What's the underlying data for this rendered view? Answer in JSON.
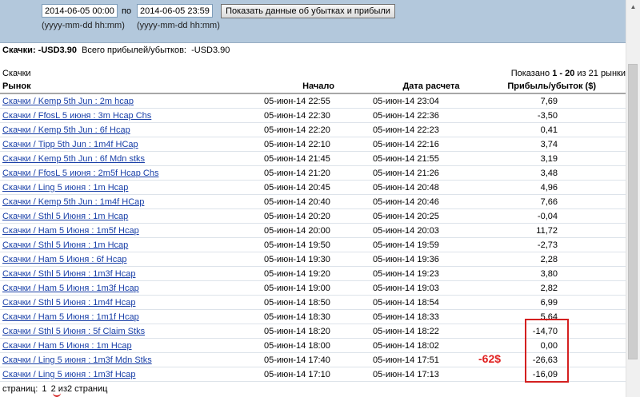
{
  "filter": {
    "date_from": "2014-06-05 00:00",
    "date_to": "2014-06-05 23:59",
    "separator": "по",
    "format_hint": "(yyyy-mm-dd hh:mm)",
    "show_button": "Показать данные об убытках и прибыли"
  },
  "summary": {
    "label": "Скачки: -USD3.90",
    "total_label": "Всего прибылей/убытков:",
    "total_value": "-USD3.90"
  },
  "section_label": "Скачки",
  "shown": {
    "prefix": "Показано",
    "range": "1 - 20",
    "suffix": "из 21 рынки"
  },
  "table": {
    "headers": [
      "Рынок",
      "Начало",
      "Дата расчета",
      "Прибыль/убыток ($)"
    ],
    "rows": [
      {
        "market": "Скачки / Kemp 5th Jun : 2m hcap",
        "start": "05-июн-14 22:55",
        "settled": "05-июн-14 23:04",
        "pl": "7,69"
      },
      {
        "market": "Скачки / FfosL 5 июня : 3m Hcap Chs",
        "start": "05-июн-14 22:30",
        "settled": "05-июн-14 22:36",
        "pl": "-3,50"
      },
      {
        "market": "Скачки / Kemp 5th Jun : 6f Hcap",
        "start": "05-июн-14 22:20",
        "settled": "05-июн-14 22:23",
        "pl": "0,41"
      },
      {
        "market": "Скачки / Tipp 5th Jun : 1m4f HCap",
        "start": "05-июн-14 22:10",
        "settled": "05-июн-14 22:16",
        "pl": "3,74"
      },
      {
        "market": "Скачки / Kemp 5th Jun : 6f Mdn stks",
        "start": "05-июн-14 21:45",
        "settled": "05-июн-14 21:55",
        "pl": "3,19"
      },
      {
        "market": "Скачки / FfosL 5 июня : 2m5f Hcap Chs",
        "start": "05-июн-14 21:20",
        "settled": "05-июн-14 21:26",
        "pl": "3,48"
      },
      {
        "market": "Скачки / Ling 5 июня : 1m Hcap",
        "start": "05-июн-14 20:45",
        "settled": "05-июн-14 20:48",
        "pl": "4,96"
      },
      {
        "market": "Скачки / Kemp 5th Jun : 1m4f HCap",
        "start": "05-июн-14 20:40",
        "settled": "05-июн-14 20:46",
        "pl": "7,66"
      },
      {
        "market": "Скачки / Sthl 5 Июня : 1m Hcap",
        "start": "05-июн-14 20:20",
        "settled": "05-июн-14 20:25",
        "pl": "-0,04"
      },
      {
        "market": "Скачки / Ham 5 Июня : 1m5f Hcap",
        "start": "05-июн-14 20:00",
        "settled": "05-июн-14 20:03",
        "pl": "11,72"
      },
      {
        "market": "Скачки / Sthl 5 Июня : 1m Hcap",
        "start": "05-июн-14 19:50",
        "settled": "05-июн-14 19:59",
        "pl": "-2,73"
      },
      {
        "market": "Скачки / Ham 5 Июня : 6f Hcap",
        "start": "05-июн-14 19:30",
        "settled": "05-июн-14 19:36",
        "pl": "2,28"
      },
      {
        "market": "Скачки / Sthl 5 Июня : 1m3f Hcap",
        "start": "05-июн-14 19:20",
        "settled": "05-июн-14 19:23",
        "pl": "3,80"
      },
      {
        "market": "Скачки / Ham 5 Июня : 1m3f Hcap",
        "start": "05-июн-14 19:00",
        "settled": "05-июн-14 19:03",
        "pl": "2,82"
      },
      {
        "market": "Скачки / Sthl 5 Июня : 1m4f Hcap",
        "start": "05-июн-14 18:50",
        "settled": "05-июн-14 18:54",
        "pl": "6,99"
      },
      {
        "market": "Скачки / Ham 5 Июня : 1m1f Hcap",
        "start": "05-июн-14 18:30",
        "settled": "05-июн-14 18:33",
        "pl": "5,64"
      },
      {
        "market": "Скачки / Sthl 5 Июня : 5f Claim Stks",
        "start": "05-июн-14 18:20",
        "settled": "05-июн-14 18:22",
        "pl": "-14,70"
      },
      {
        "market": "Скачки / Ham 5 Июня : 1m Hcap",
        "start": "05-июн-14 18:00",
        "settled": "05-июн-14 18:02",
        "pl": "0,00"
      },
      {
        "market": "Скачки / Ling 5 июня : 1m3f Mdn Stks",
        "start": "05-июн-14 17:40",
        "settled": "05-июн-14 17:51",
        "pl": "-26,63"
      },
      {
        "market": "Скачки / Ling 5 июня : 1m3f Hcap",
        "start": "05-июн-14 17:10",
        "settled": "05-июн-14 17:13",
        "pl": "-16,09"
      }
    ]
  },
  "pager": {
    "label": "страниц:",
    "page1": "1",
    "page2": "2",
    "total": "из2 страниц"
  },
  "annotation": {
    "loss_text": "-62$",
    "color": "#d42020"
  }
}
